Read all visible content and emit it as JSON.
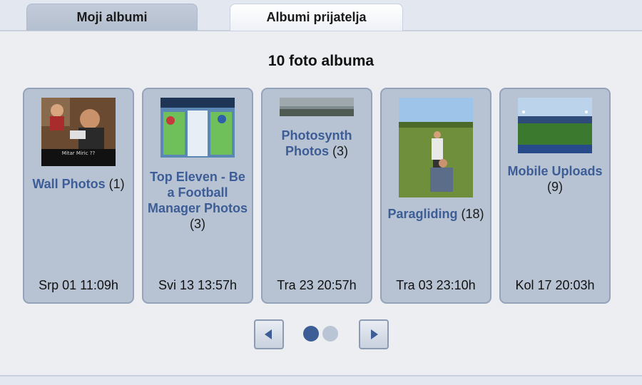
{
  "tabs": {
    "my_albums": "Moji albumi",
    "friends_albums": "Albumi prijatelja"
  },
  "heading": "10 foto albuma",
  "albums": [
    {
      "name": "Wall Photos",
      "count": "(1)",
      "date": "Srp 01 11:09h",
      "thumb_caption": "Mitar Miric ??"
    },
    {
      "name": "Top Eleven - Be a Football Manager Photos",
      "count": "(3)",
      "date": "Svi 13 13:57h"
    },
    {
      "name": "Photosynth Photos",
      "count": "(3)",
      "date": "Tra 23 20:57h"
    },
    {
      "name": "Paragliding",
      "count": "(18)",
      "date": "Tra 03 23:10h"
    },
    {
      "name": "Mobile Uploads",
      "count": "(9)",
      "date": "Kol 17 20:03h"
    }
  ],
  "pagination": {
    "pages": 2,
    "current": 1,
    "active_color": "#3c5d96",
    "inactive_color": "#b9c4d5"
  },
  "icons": {
    "prev": "left-arrow-icon",
    "next": "right-arrow-icon"
  }
}
